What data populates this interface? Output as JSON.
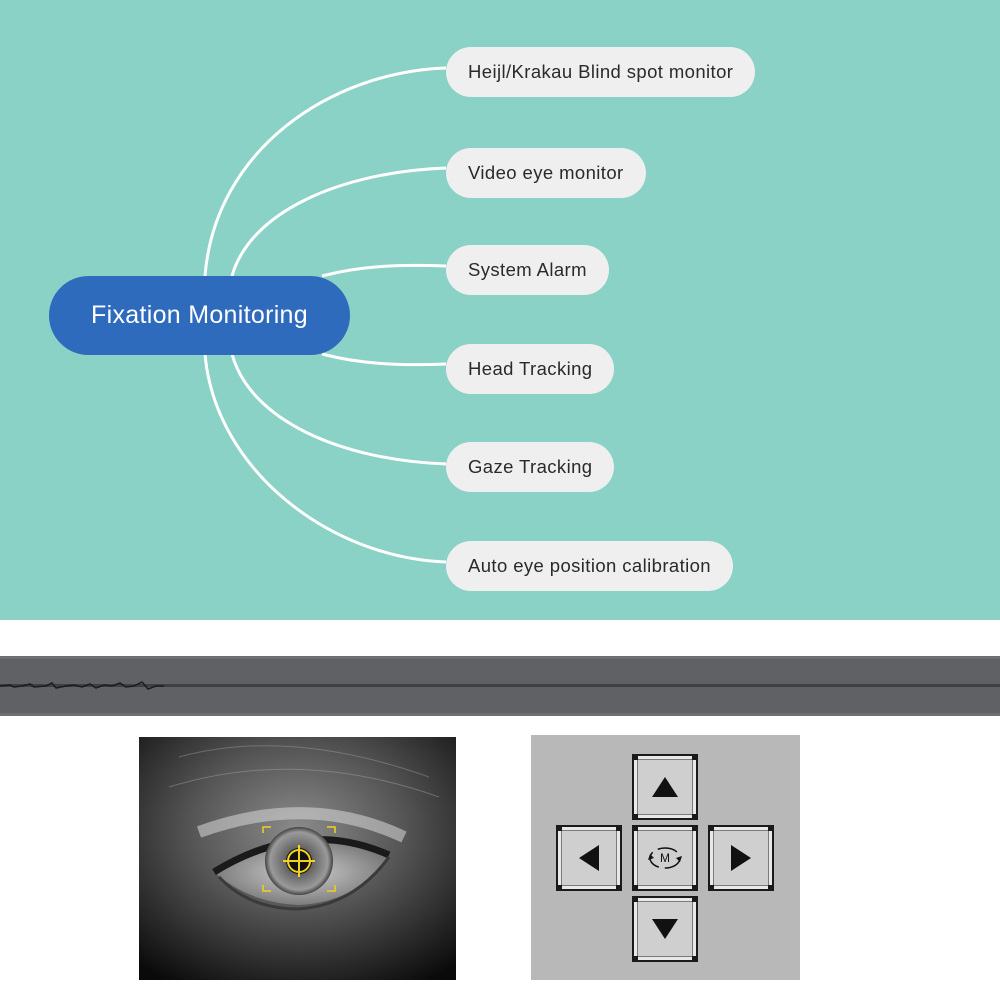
{
  "mindmap": {
    "center": {
      "label": "Fixation Monitoring"
    },
    "branches": [
      {
        "label": "Heijl/Krakau Blind spot monitor"
      },
      {
        "label": "Video eye monitor"
      },
      {
        "label": "System Alarm"
      },
      {
        "label": "Head Tracking"
      },
      {
        "label": "Gaze Tracking"
      },
      {
        "label": "Auto eye position calibration"
      }
    ]
  },
  "colors": {
    "mindmap_background": "#8ad1c6",
    "center_node": "#2e6bbd",
    "branch_node": "#efefef",
    "connector": "#ffffff",
    "tracking_marker": "#f2d21b"
  },
  "eye_monitor": {
    "marker_icon": "crosshair-icon"
  },
  "direction_pad": {
    "buttons": [
      {
        "direction": "up",
        "icon": "arrow-up-icon"
      },
      {
        "direction": "left",
        "icon": "arrow-left-icon"
      },
      {
        "direction": "center",
        "icon": "rotate-icon",
        "label": "M"
      },
      {
        "direction": "right",
        "icon": "arrow-right-icon"
      },
      {
        "direction": "down",
        "icon": "arrow-down-icon"
      }
    ]
  }
}
